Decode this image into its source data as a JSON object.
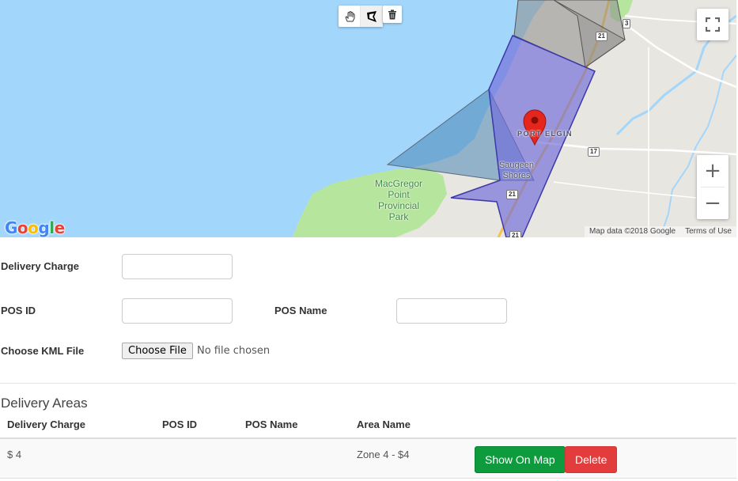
{
  "colors": {
    "water": "#a3d6fb",
    "land": "#e8e6e1",
    "park": "#b6e59e",
    "zone_blue": "#6f6ad8",
    "zone_gray": "#8c8c8c",
    "zone_steel": "#4a86b8",
    "marker": "#e5261d",
    "btn_success": "#0d9b3e",
    "btn_danger": "#e23c3c"
  },
  "map": {
    "labels": {
      "park": [
        "MacGregor",
        "Point",
        "Provincial",
        "Park"
      ],
      "town": [
        "Saugeen",
        "Shores"
      ],
      "pos_elgin": "PORT ELGIN"
    },
    "road_shields": [
      "3",
      "21",
      "17",
      "21",
      "21"
    ],
    "toolbar": {
      "pan_icon": "hand-icon",
      "polygon_icon": "polygon-icon",
      "trash_icon": "trash-icon"
    },
    "controls": {
      "fullscreen_icon": "fullscreen-icon",
      "zoom_in": "+",
      "zoom_out": "−"
    },
    "attribution": "Map data ©2018 Google",
    "terms": "Terms of Use"
  },
  "form": {
    "delivery_charge": {
      "label": "Delivery Charge",
      "value": ""
    },
    "pos_id": {
      "label": "POS ID",
      "value": ""
    },
    "pos_name": {
      "label": "POS Name",
      "value": ""
    },
    "kml": {
      "label": "Choose KML File",
      "button": "Choose File",
      "status": "No file chosen"
    }
  },
  "delivery_areas": {
    "title": "Delivery Areas",
    "columns": [
      "Delivery Charge",
      "POS ID",
      "POS Name",
      "Area Name"
    ],
    "rows": [
      {
        "delivery_charge": "$ 4",
        "pos_id": "",
        "pos_name": "",
        "area_name": "Zone 4 - $4",
        "show_button": "Show On Map",
        "delete_button": "Delete"
      }
    ]
  }
}
